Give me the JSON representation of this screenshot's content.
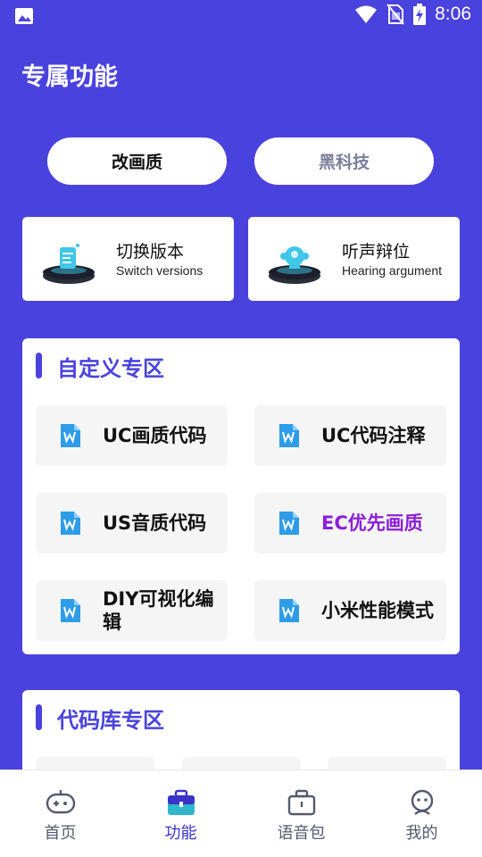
{
  "status_bar": {
    "time": "8:06",
    "left_icon": "image-icon",
    "right_icons": [
      "wifi-icon",
      "no-sim-icon",
      "battery-charging-icon"
    ]
  },
  "header": {
    "title": "专属功能"
  },
  "segments": [
    {
      "label": "改画质",
      "active": true
    },
    {
      "label": "黑科技",
      "active": false
    }
  ],
  "feature_cards": [
    {
      "title": "切换版本",
      "subtitle": "Switch versions",
      "icon": "document-pedestal-icon"
    },
    {
      "title": "听声辩位",
      "subtitle": "Hearing argument",
      "icon": "ear-pedestal-icon"
    }
  ],
  "custom_zone": {
    "heading": "自定义专区",
    "items": [
      {
        "label": "UC画质代码",
        "icon": "wps-doc-icon"
      },
      {
        "label": "UC代码注释",
        "icon": "wps-doc-icon"
      },
      {
        "label": "US音质代码",
        "icon": "wps-doc-icon"
      },
      {
        "label": "EC优先画质",
        "icon": "wps-doc-icon",
        "highlight": "#8b1fd8"
      },
      {
        "label": "DIY可视化编辑",
        "icon": "wps-doc-icon"
      },
      {
        "label": "小米性能模式",
        "icon": "wps-doc-icon"
      }
    ]
  },
  "code_library": {
    "heading": "代码库专区"
  },
  "tabs": [
    {
      "label": "首页",
      "icon": "gamepad-icon",
      "active": false
    },
    {
      "label": "功能",
      "icon": "toolbox-icon",
      "active": true
    },
    {
      "label": "语音包",
      "icon": "briefcase-icon",
      "active": false
    },
    {
      "label": "我的",
      "icon": "robot-face-icon",
      "active": false
    }
  ],
  "colors": {
    "brand": "#4a42dd",
    "active_tab": "#3a33c9",
    "highlight": "#8b1fd8",
    "card_bg": "#f5f5f5"
  }
}
